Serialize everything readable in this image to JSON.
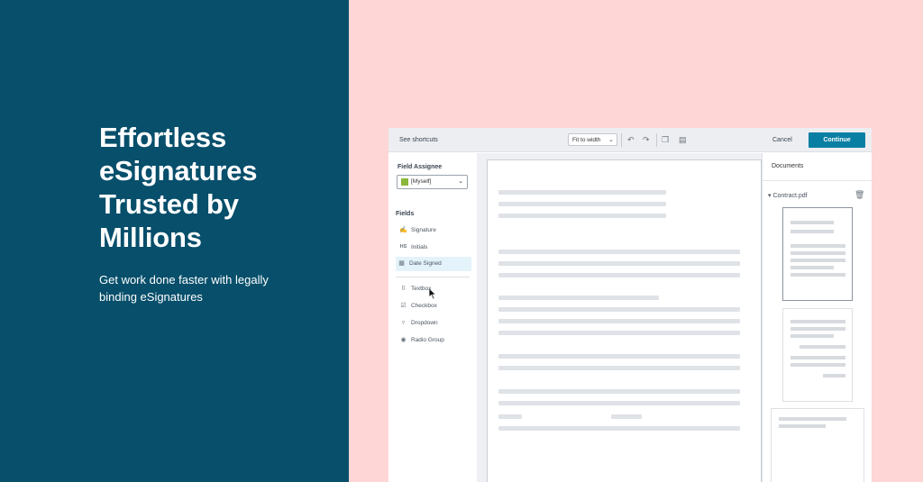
{
  "colors": {
    "brand": "#074f6b",
    "pink": "#ffd6d6",
    "accent": "#0a7fa4"
  },
  "hero": {
    "title": "Effortless\neSignatures\nTrusted by\nMillions",
    "subtitle": "Get work done faster with legally binding eSignatures"
  },
  "toolbar": {
    "shortcuts": "See shortcuts",
    "zoom": "Fit to width",
    "undo_icon": "undo-icon",
    "redo_icon": "redo-icon",
    "copy_icon": "copy-icon",
    "paste_icon": "paste-icon",
    "cancel": "Cancel",
    "continue": "Continue"
  },
  "sidebar": {
    "assignee_label": "Field Assignee",
    "assignee_value": "[Myself]",
    "fields_label": "Fields",
    "items": [
      {
        "label": "Signature",
        "icon": "signature-icon"
      },
      {
        "label": "Initials",
        "icon": "initials-icon"
      },
      {
        "label": "Date Signed",
        "icon": "calendar-icon"
      },
      {
        "label": "Textbox",
        "icon": "textbox-icon"
      },
      {
        "label": "Checkbox",
        "icon": "checkbox-icon"
      },
      {
        "label": "Dropdown",
        "icon": "dropdown-icon"
      },
      {
        "label": "Radio Group",
        "icon": "radio-icon"
      }
    ]
  },
  "documents": {
    "title": "Documents",
    "file": "Contract.pdf"
  }
}
